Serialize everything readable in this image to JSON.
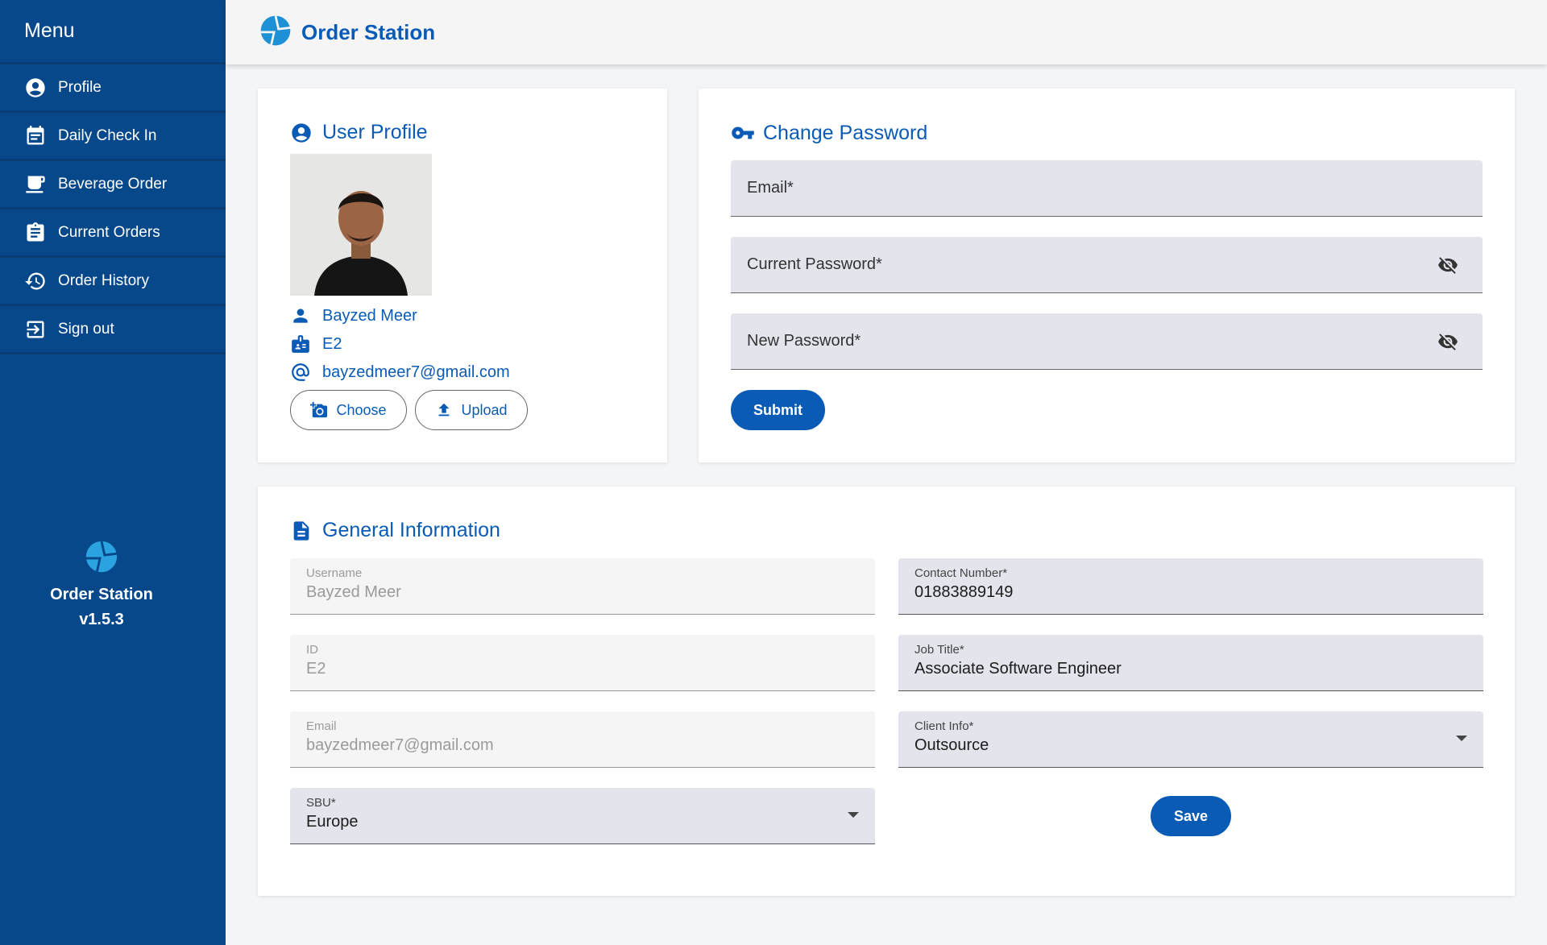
{
  "sidebar": {
    "menu_title": "Menu",
    "items": [
      {
        "label": "Profile",
        "icon": "account-circle-icon"
      },
      {
        "label": "Daily Check In",
        "icon": "calendar-icon"
      },
      {
        "label": "Beverage Order",
        "icon": "coffee-icon"
      },
      {
        "label": "Current Orders",
        "icon": "clipboard-icon"
      },
      {
        "label": "Order History",
        "icon": "history-icon"
      },
      {
        "label": "Sign out",
        "icon": "sign-out-icon"
      }
    ],
    "brand_name": "Order Station",
    "version": "v1.5.3"
  },
  "header": {
    "app_title": "Order Station"
  },
  "profile": {
    "title": "User Profile",
    "name": "Bayzed Meer",
    "id": "E2",
    "email": "bayzedmeer7@gmail.com",
    "choose_label": "Choose",
    "upload_label": "Upload"
  },
  "password": {
    "title": "Change Password",
    "email_label": "Email*",
    "current_label": "Current Password*",
    "new_label": "New Password*",
    "submit_label": "Submit"
  },
  "general": {
    "title": "General Information",
    "username_label": "Username",
    "username_value": "Bayzed Meer",
    "id_label": "ID",
    "id_value": "E2",
    "email_label": "Email",
    "email_value": "bayzedmeer7@gmail.com",
    "sbu_label": "SBU*",
    "sbu_value": "Europe",
    "contact_label": "Contact Number*",
    "contact_value": "01883889149",
    "job_label": "Job Title*",
    "job_value": "Associate Software Engineer",
    "client_label": "Client Info*",
    "client_value": "Outsource",
    "save_label": "Save"
  },
  "colors": {
    "sidebar_bg": "#07488a",
    "accent": "#0a5bb5",
    "field_bg": "#e3e4ec"
  }
}
